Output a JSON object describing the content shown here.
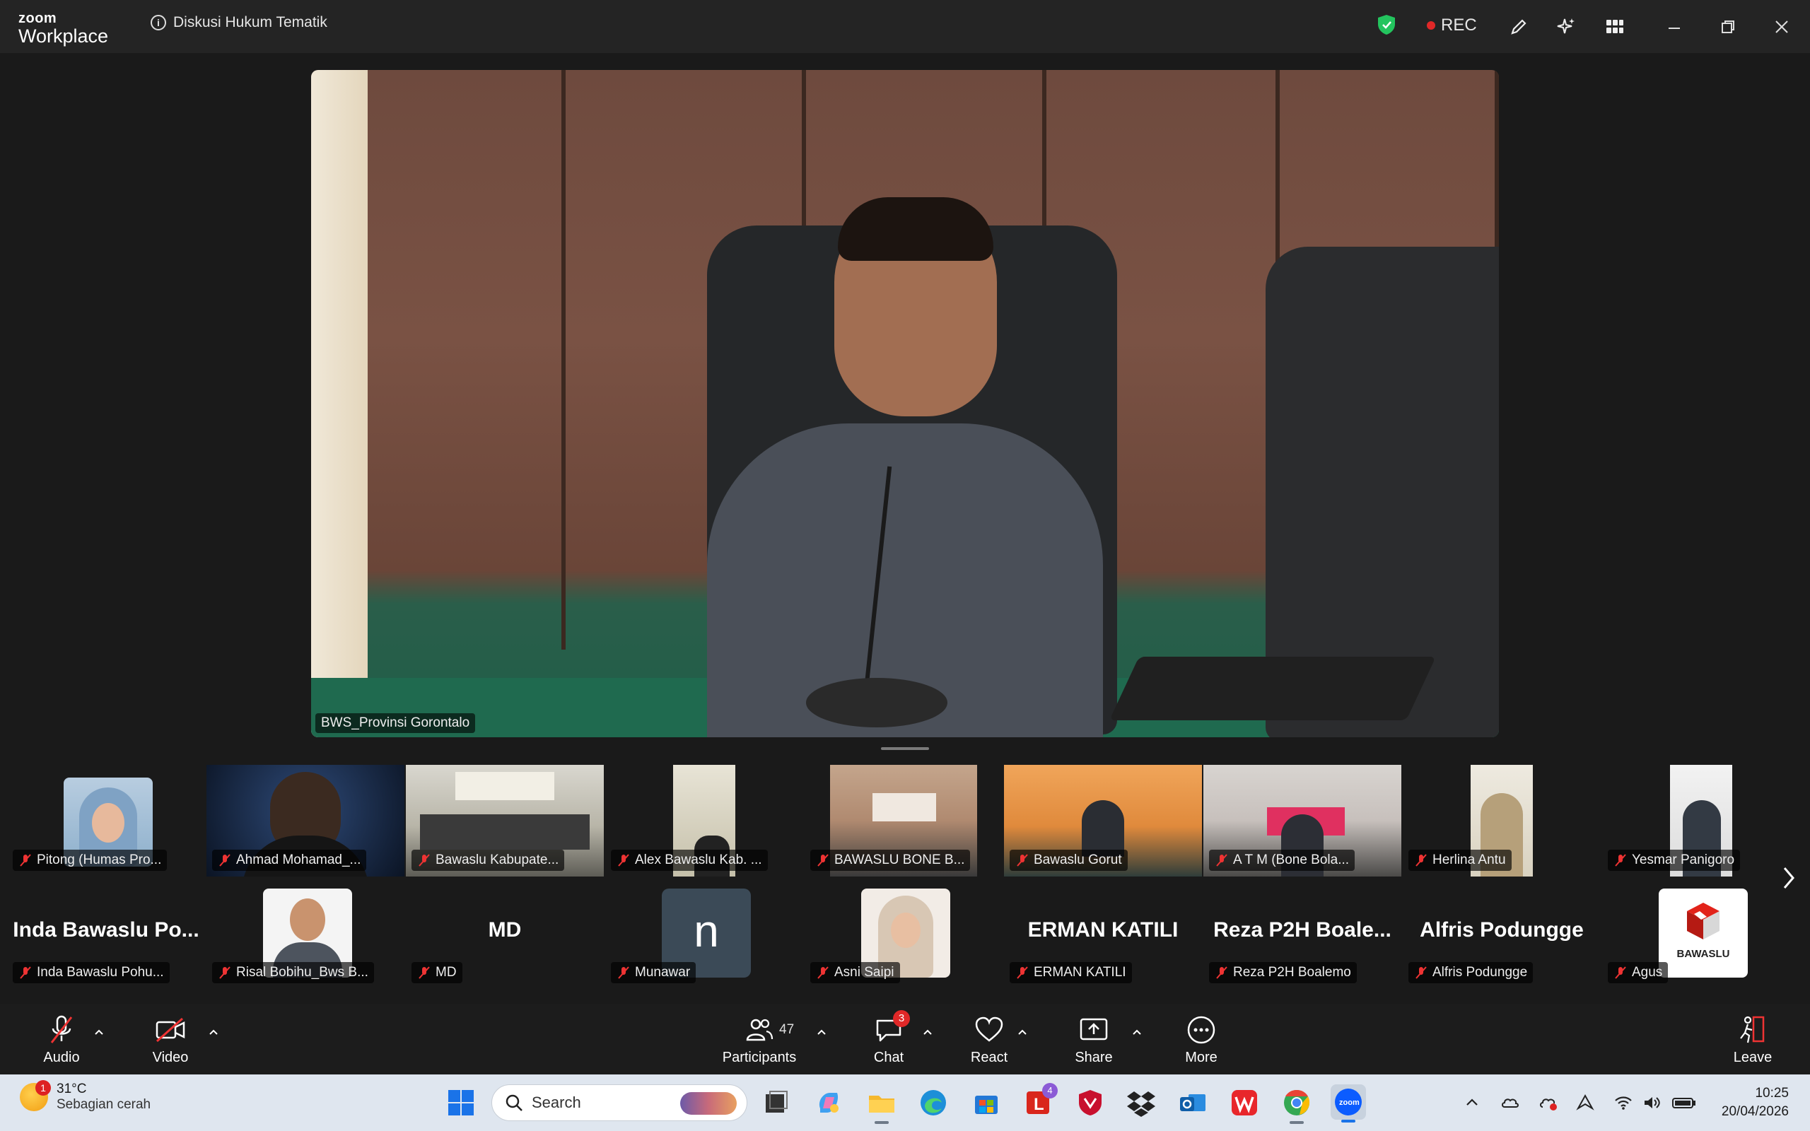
{
  "app": {
    "brand_top": "zoom",
    "brand_bottom": "Workplace",
    "meeting_title": "Diskusi Hukum Tematik",
    "rec_label": "REC"
  },
  "main_video": {
    "participant": "BWS_Provinsi Gorontalo"
  },
  "gallery_row1": [
    {
      "label": "Pitong (Humas Pro..."
    },
    {
      "label": "Ahmad Mohamad_..."
    },
    {
      "label": "Bawaslu Kabupate..."
    },
    {
      "label": "Alex Bawaslu Kab. ..."
    },
    {
      "label": "BAWASLU BONE B..."
    },
    {
      "label": "Bawaslu Gorut"
    },
    {
      "label": "A T M  (Bone Bola..."
    },
    {
      "label": "Herlina Antu"
    },
    {
      "label": "Yesmar Panigoro"
    }
  ],
  "gallery_row2": [
    {
      "big": "Inda  Bawaslu  Po...",
      "label": "Inda Bawaslu Pohu..."
    },
    {
      "big": "",
      "label": "Risal Bobihu_Bws B..."
    },
    {
      "big": "MD",
      "label": "MD"
    },
    {
      "big": "n",
      "label": "Munawar"
    },
    {
      "big": "",
      "label": "Asni Saipi"
    },
    {
      "big": "ERMAN KATILI",
      "label": "ERMAN KATILI"
    },
    {
      "big": "Reza  P2H  Boale...",
      "label": "Reza P2H Boalemo"
    },
    {
      "big": "Alfris Podungge",
      "label": "Alfris Podungge"
    },
    {
      "big": "BAWASLU",
      "label": "Agus"
    }
  ],
  "toolbar": {
    "audio": "Audio",
    "video": "Video",
    "participants": "Participants",
    "participants_count": "47",
    "chat": "Chat",
    "chat_badge": "3",
    "react": "React",
    "share": "Share",
    "more": "More",
    "leave": "Leave"
  },
  "taskbar": {
    "weather_temp": "31°C",
    "weather_desc": "Sebagian cerah",
    "weather_badge": "1",
    "search_placeholder": "Search",
    "mail_badge": "4",
    "time": "10:25",
    "date": "20/04/2026"
  }
}
